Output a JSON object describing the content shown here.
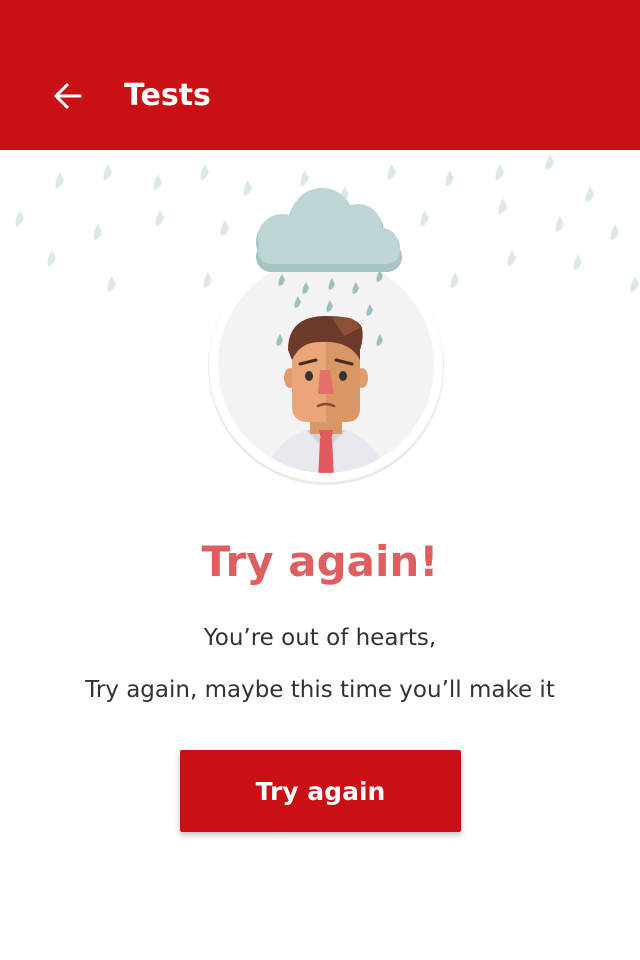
{
  "app_bar": {
    "title": "Tests",
    "back_icon": "arrow-left-icon",
    "background": "#c81015"
  },
  "illustration": {
    "subject": "sad-man-under-rain-cloud",
    "icons": [
      "rain-cloud-icon",
      "raindrop-icon",
      "sad-man-avatar"
    ]
  },
  "result": {
    "title": "Try again!",
    "title_color": "#df5f60",
    "message_line_1": "You’re out of hearts,",
    "message_line_2": "Try again, maybe this time you’ll make it"
  },
  "actions": {
    "retry_label": "Try again",
    "button_color": "#c81015"
  }
}
